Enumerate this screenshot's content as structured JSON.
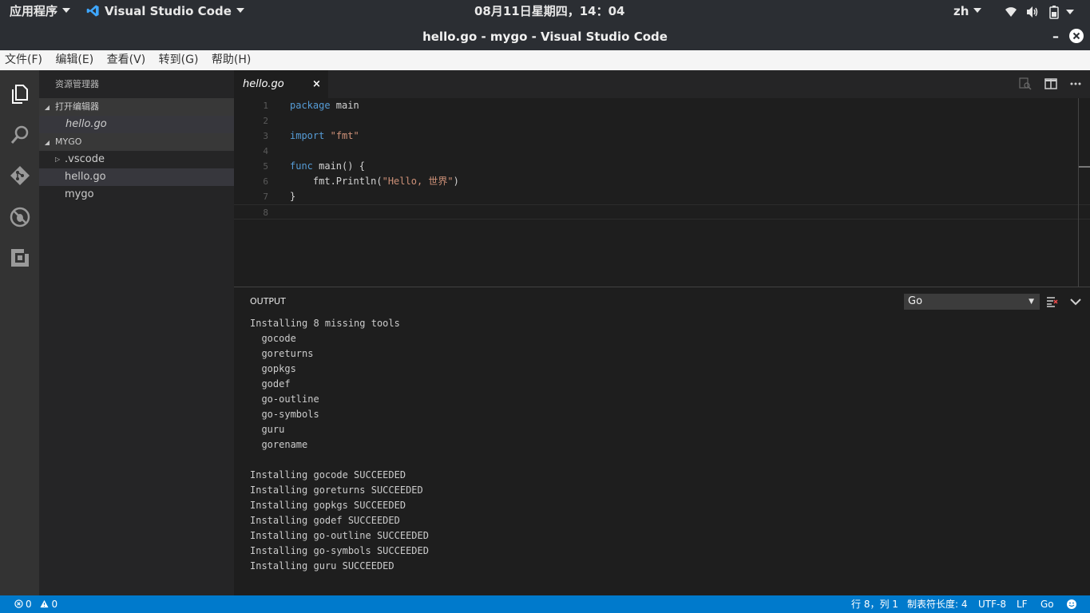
{
  "topbar": {
    "apps_label": "应用程序",
    "app_name": "Visual Studio Code",
    "clock": "08月11日星期四，14：04",
    "lang": "zh"
  },
  "window": {
    "title": "hello.go - mygo - Visual Studio Code",
    "minimize": "–",
    "close": "✕"
  },
  "menubar": {
    "items": [
      "文件(F)",
      "编辑(E)",
      "查看(V)",
      "转到(G)",
      "帮助(H)"
    ]
  },
  "sidebar": {
    "title": "资源管理器",
    "open_editors_title": "打开编辑器",
    "open_editors": [
      "hello.go"
    ],
    "folder_title": "MYGO",
    "files": [
      ".vscode",
      "hello.go",
      "mygo"
    ]
  },
  "tab": {
    "label": "hello.go",
    "close": "×"
  },
  "editor": {
    "line_numbers": [
      "1",
      "2",
      "3",
      "4",
      "5",
      "6",
      "7",
      "8"
    ],
    "lines": [
      {
        "kw": "package",
        "rest": " main",
        "str": ""
      },
      {
        "kw": "",
        "rest": "",
        "str": ""
      },
      {
        "kw": "import",
        "rest": " ",
        "str": "\"fmt\""
      },
      {
        "kw": "",
        "rest": "",
        "str": ""
      },
      {
        "kw": "func",
        "rest": " main() {",
        "str": ""
      },
      {
        "kw": "",
        "rest": "    fmt.Println(",
        "str": "\"Hello, 世界\"",
        "tail": ")"
      },
      {
        "kw": "",
        "rest": "}",
        "str": ""
      },
      {
        "kw": "",
        "rest": "",
        "str": ""
      }
    ]
  },
  "panel": {
    "title": "OUTPUT",
    "channel": "Go",
    "lines": [
      "Installing 8 missing tools",
      "  gocode",
      "  goreturns",
      "  gopkgs",
      "  godef",
      "  go-outline",
      "  go-symbols",
      "  guru",
      "  gorename",
      "",
      "Installing gocode SUCCEEDED",
      "Installing goreturns SUCCEEDED",
      "Installing gopkgs SUCCEEDED",
      "Installing godef SUCCEEDED",
      "Installing go-outline SUCCEEDED",
      "Installing go-symbols SUCCEEDED",
      "Installing guru SUCCEEDED"
    ]
  },
  "statusbar": {
    "errors": "0",
    "warnings": "0",
    "position": "行 8，列 1",
    "tab_size": "制表符长度: 4",
    "encoding": "UTF-8",
    "eol": "LF",
    "language": "Go"
  },
  "colors": {
    "accent": "#007acc",
    "keyword": "#569cd6",
    "string": "#ce9178"
  }
}
